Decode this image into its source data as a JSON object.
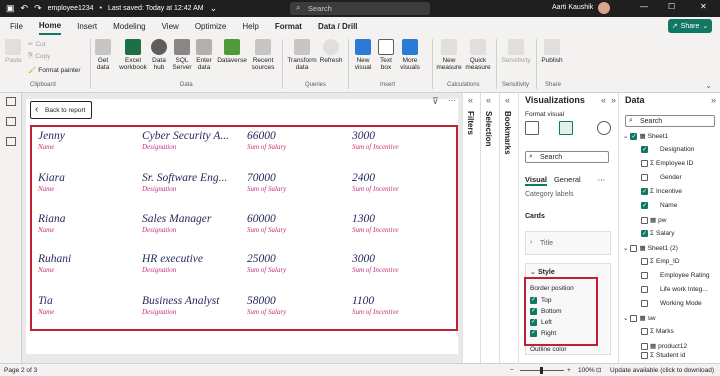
{
  "titlebar": {
    "file_name": "employee1234",
    "saved": "Last saved: Today at 12:42 AM",
    "search_placeholder": "Search",
    "user": "Aarti Kaushik"
  },
  "menu": {
    "tabs": [
      "File",
      "Home",
      "Insert",
      "Modeling",
      "View",
      "Optimize",
      "Help",
      "Format",
      "Data / Drill"
    ],
    "active": "Home",
    "share": "Share"
  },
  "ribbon": {
    "clipboard": {
      "paste": "Paste",
      "cut": "Cut",
      "copy": "Copy",
      "format_painter": "Format painter",
      "group": "Clipboard"
    },
    "data": {
      "get_data": "Get data",
      "excel": "Excel workbook",
      "hub": "Data hub",
      "sql": "SQL Server",
      "enter": "Enter data",
      "dataverse": "Dataverse",
      "recent": "Recent sources",
      "group": "Data"
    },
    "queries": {
      "transform": "Transform data",
      "refresh": "Refresh",
      "group": "Queries"
    },
    "insert": {
      "new_visual": "New visual",
      "text_box": "Text box",
      "more": "More visuals",
      "group": "Insert"
    },
    "calc": {
      "new_measure": "New measure",
      "quick_measure": "Quick measure",
      "group": "Calculations"
    },
    "sensitivity": {
      "label": "Sensitivity",
      "group": "Sensitivity"
    },
    "share": {
      "publish": "Publish",
      "group": "Share"
    }
  },
  "canvas": {
    "back_button": "Back to report",
    "rows": [
      {
        "name": "Jenny",
        "designation": "Cyber Security A...",
        "salary": "66000",
        "incentive": "3000"
      },
      {
        "name": "Kiara",
        "designation": "Sr. Software Eng...",
        "salary": "70000",
        "incentive": "2400"
      },
      {
        "name": "Riana",
        "designation": "Sales Manager",
        "salary": "60000",
        "incentive": "1300"
      },
      {
        "name": "Ruhani",
        "designation": "HR executive",
        "salary": "25000",
        "incentive": "3000"
      },
      {
        "name": "Tia",
        "designation": "Business Analyst",
        "salary": "58000",
        "incentive": "1100"
      }
    ],
    "labels": {
      "name": "Name",
      "designation": "Designation",
      "salary": "Sum of Salary",
      "incentive": "Sum of Incentive"
    }
  },
  "side_tabs": {
    "filters": "Filters",
    "selection": "Selection",
    "bookmarks": "Bookmarks"
  },
  "visualizations": {
    "title": "Visualizations",
    "format_visual": "Format visual",
    "search_placeholder": "Search",
    "tabs": [
      "Visual",
      "General"
    ],
    "category_labels": "Category labels",
    "cards": "Cards",
    "title_section": "Title",
    "style": "Style",
    "border_position": "Border position",
    "borders": [
      "Top",
      "Bottom",
      "Left",
      "Right"
    ],
    "outline_color": "Outline color"
  },
  "data_pane": {
    "title": "Data",
    "search_placeholder": "Search",
    "tables": [
      {
        "name": "Sheet1",
        "fields": [
          {
            "name": "Designation",
            "checked": true,
            "sigma": false
          },
          {
            "name": "Employee ID",
            "checked": false,
            "sigma": true
          },
          {
            "name": "Gender",
            "checked": false,
            "sigma": false
          },
          {
            "name": "Incentive",
            "checked": true,
            "sigma": true
          },
          {
            "name": "Name",
            "checked": true,
            "sigma": false
          },
          {
            "name": "pw",
            "checked": false,
            "sigma": false
          },
          {
            "name": "Salary",
            "checked": true,
            "sigma": true
          }
        ]
      },
      {
        "name": "Sheet1 (2)",
        "fields": [
          {
            "name": "Emp_ID",
            "checked": false,
            "sigma": true
          },
          {
            "name": "Employee Rating",
            "checked": false,
            "sigma": false
          },
          {
            "name": "Life work Integ...",
            "checked": false,
            "sigma": false
          },
          {
            "name": "Working Mode",
            "checked": false,
            "sigma": false
          }
        ]
      },
      {
        "name": "sw",
        "fields": [
          {
            "name": "Marks",
            "checked": false,
            "sigma": true
          },
          {
            "name": "product12",
            "checked": false,
            "sigma": false
          },
          {
            "name": "Student id",
            "checked": false,
            "sigma": true
          }
        ]
      }
    ]
  },
  "status": {
    "page": "Page 2 of 3",
    "zoom": "100%",
    "update": "Update available (click to download)"
  },
  "colors": {
    "accent": "#117865",
    "card_value": "#252a5b",
    "card_label": "#c4317a",
    "border": "#c0202f"
  }
}
